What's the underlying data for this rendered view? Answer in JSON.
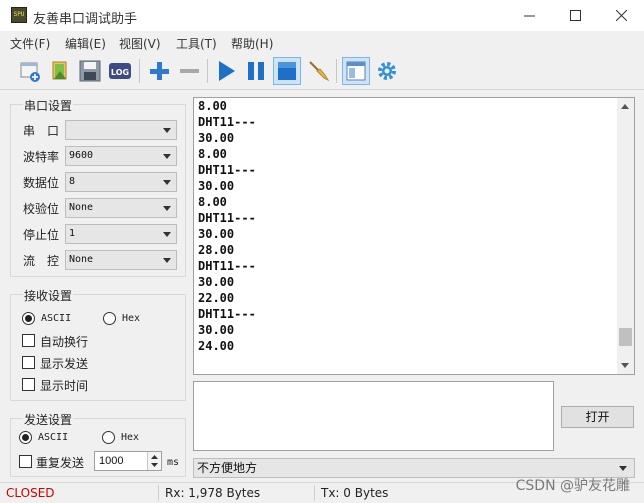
{
  "window": {
    "title": "友善串口调试助手",
    "app_icon_text": "SPU"
  },
  "menu": [
    "文件(F)",
    "编辑(E)",
    "视图(V)",
    "工具(T)",
    "帮助(H)"
  ],
  "toolbar": {
    "icons": [
      "new-window-icon",
      "open-icon",
      "save-icon",
      "log-icon",
      "add-icon",
      "remove-icon",
      "play-icon",
      "pause-icon",
      "stop-icon",
      "clear-broom-icon",
      "panel-layout-icon",
      "settings-gear-icon"
    ],
    "log_text": "LOG"
  },
  "serial_settings": {
    "title": "串口设置",
    "fields": [
      {
        "label": "串　口",
        "value": ""
      },
      {
        "label": "波特率",
        "value": "9600"
      },
      {
        "label": "数据位",
        "value": "8"
      },
      {
        "label": "校验位",
        "value": "None"
      },
      {
        "label": "停止位",
        "value": "1"
      },
      {
        "label": "流　控",
        "value": "None"
      }
    ]
  },
  "receive_settings": {
    "title": "接收设置",
    "ascii_label": "ASCII",
    "hex_label": "Hex",
    "selected": "ASCII",
    "options": [
      {
        "label": "自动换行",
        "checked": false
      },
      {
        "label": "显示发送",
        "checked": false
      },
      {
        "label": "显示时间",
        "checked": false
      }
    ]
  },
  "send_settings": {
    "title": "发送设置",
    "ascii_label": "ASCII",
    "hex_label": "Hex",
    "selected": "ASCII",
    "repeat_label": "重复发送",
    "repeat_checked": false,
    "interval_value": "1000",
    "interval_unit": "ms"
  },
  "receive_lines": [
    "8.00",
    "DHT11---",
    "30.00",
    "8.00",
    "DHT11---",
    "30.00",
    "8.00",
    "DHT11---",
    "30.00",
    "28.00",
    "DHT11---",
    "30.00",
    "22.00",
    "DHT11---",
    "30.00",
    "24.00"
  ],
  "scroll_position": 0.95,
  "open_button": "打开",
  "bottom_select": "不方便地方",
  "status": {
    "state": "CLOSED",
    "state_color": "#d00000",
    "rx": "Rx: 1,978 Bytes",
    "tx": "Tx: 0 Bytes"
  },
  "watermark": "CSDN @驴友花雕",
  "colors": {
    "accent_blue": "#1e6fc8",
    "toolbar_active": "#cde4f7"
  }
}
